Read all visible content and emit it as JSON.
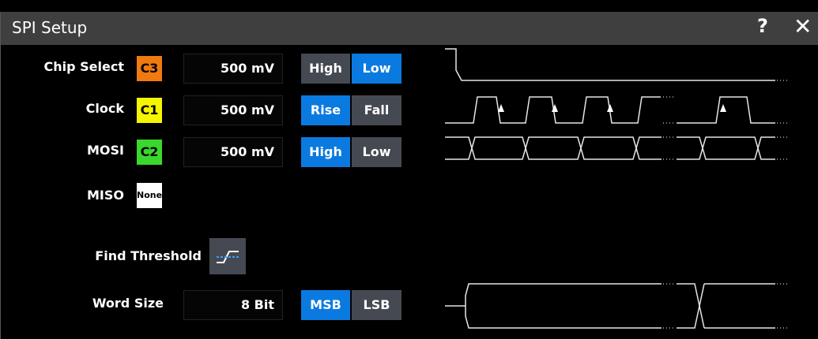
{
  "title": "SPI Setup",
  "icons": {
    "help": "question-mark-icon",
    "close": "close-x-icon",
    "threshold": "threshold-edge-icon"
  },
  "colors": {
    "c3": "#f07a10",
    "c1": "#f5f500",
    "c2": "#3ad82e",
    "none": "#ffffff",
    "active": "#0b7ae0",
    "inactive": "#454a52",
    "title_bar": "#3f3f3f"
  },
  "glyphs": {
    "help": "?",
    "close": "✕"
  },
  "chip_select": {
    "label": "Chip Select",
    "source": "C3",
    "threshold": "500 mV",
    "options": [
      "High",
      "Low"
    ],
    "selected": "Low"
  },
  "clock": {
    "label": "Clock",
    "source": "C1",
    "threshold": "500 mV",
    "options": [
      "Rise",
      "Fall"
    ],
    "selected": "Rise"
  },
  "mosi": {
    "label": "MOSI",
    "source": "C2",
    "threshold": "500 mV",
    "options": [
      "High",
      "Low"
    ],
    "selected": "High"
  },
  "miso": {
    "label": "MISO",
    "source": "None"
  },
  "find_threshold": {
    "label": "Find Threshold"
  },
  "word_size": {
    "label": "Word Size",
    "value": "8 Bit",
    "options": [
      "MSB",
      "LSB"
    ],
    "selected": "MSB"
  }
}
